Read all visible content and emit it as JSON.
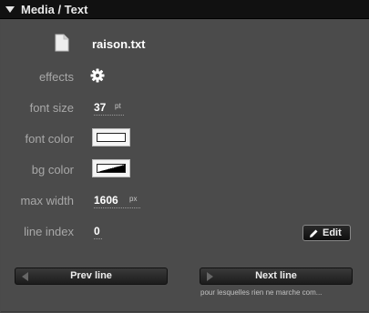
{
  "header": {
    "title": "Media / Text"
  },
  "file": {
    "icon": "document-icon",
    "name": "raison.txt"
  },
  "effects": {
    "label": "effects",
    "icon": "gear-icon"
  },
  "font_size": {
    "label": "font size",
    "value": "37",
    "unit": "pt"
  },
  "font_color": {
    "label": "font color",
    "swatch": "#ffffff"
  },
  "bg_color": {
    "label": "bg color",
    "swatch_style": "black-white-gradient"
  },
  "max_width": {
    "label": "max width",
    "value": "1606",
    "unit": "px"
  },
  "line_index": {
    "label": "line index",
    "value": "0",
    "edit_label": "Edit",
    "edit_icon": "pencil-icon"
  },
  "nav": {
    "prev_label": "Prev line",
    "next_label": "Next line",
    "next_caption": "pour lesquelles rien ne marche com..."
  },
  "colors": {
    "panel_bg": "#4b4b4b",
    "header_bg": "#111111",
    "label": "#a8a8a8",
    "value": "#ffffff"
  }
}
